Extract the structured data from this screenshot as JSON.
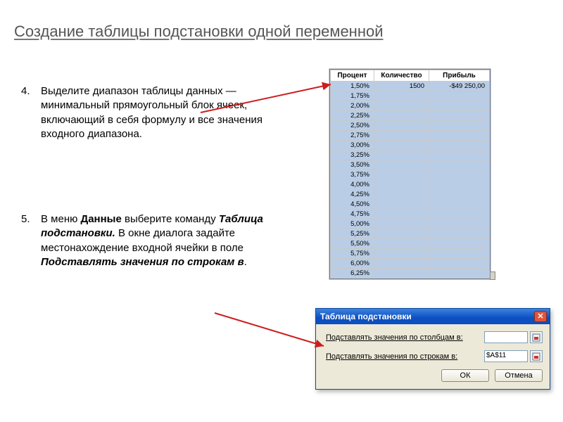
{
  "title": "Создание таблицы подстановки одной переменной",
  "instructions": {
    "i4": {
      "num": "4.",
      "text_a": "Выделите диапазон таблицы данных — минимальный прямоугольный блок ячеек, включающий в себя формулу и все значения входного диапазона."
    },
    "i5": {
      "num": "5.",
      "prefix": "В меню ",
      "bold1": "Данные",
      "mid1": " выберите команду ",
      "bolditalic1": "Таблица подстановки.",
      "mid2": " В окне диалога задайте местонахождение входной ячейки в поле ",
      "bolditalic2": "Подставлять значения по строкам в",
      "suffix": "."
    }
  },
  "excel": {
    "headers": {
      "a": "Процент",
      "b": "Количество",
      "c": "Прибыль"
    },
    "first_row_qty": "1500",
    "first_row_profit": "-$49 250,00",
    "pcts": [
      "1,50%",
      "1,75%",
      "2,00%",
      "2,25%",
      "2,50%",
      "2,75%",
      "3,00%",
      "3,25%",
      "3,50%",
      "3,75%",
      "4,00%",
      "4,25%",
      "4,50%",
      "4,75%",
      "5,00%",
      "5,25%",
      "5,50%",
      "5,75%",
      "6,00%",
      "6,25%"
    ]
  },
  "dialog": {
    "title": "Таблица подстановки",
    "row_cols_label": "Подставлять значения по столбцам в:",
    "row_rows_label": "Подставлять значения по строкам в:",
    "row_rows_value": "$A$11",
    "ok": "ОК",
    "cancel": "Отмена"
  }
}
